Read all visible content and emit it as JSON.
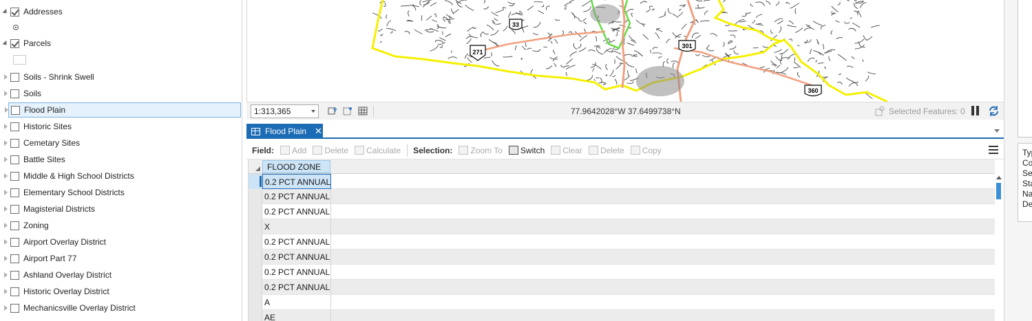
{
  "contents": {
    "layers": [
      {
        "label": "Addresses",
        "checked": true,
        "expanded": true,
        "selected": false
      },
      {
        "label": "Parcels",
        "checked": true,
        "expanded": true,
        "selected": false
      },
      {
        "label": "Soils - Shrink Swell",
        "checked": false,
        "expanded": false,
        "selected": false
      },
      {
        "label": "Soils",
        "checked": false,
        "expanded": false,
        "selected": false
      },
      {
        "label": "Flood Plain",
        "checked": false,
        "expanded": false,
        "selected": true
      },
      {
        "label": "Historic Sites",
        "checked": false,
        "expanded": false,
        "selected": false
      },
      {
        "label": "Cemetary Sites",
        "checked": false,
        "expanded": false,
        "selected": false
      },
      {
        "label": "Battle Sites",
        "checked": false,
        "expanded": false,
        "selected": false
      },
      {
        "label": "Middle & High School Districts",
        "checked": false,
        "expanded": false,
        "selected": false
      },
      {
        "label": "Elementary School Districts",
        "checked": false,
        "expanded": false,
        "selected": false
      },
      {
        "label": "Magisterial Districts",
        "checked": false,
        "expanded": false,
        "selected": false
      },
      {
        "label": "Zoning",
        "checked": false,
        "expanded": false,
        "selected": false
      },
      {
        "label": "Airport Overlay District",
        "checked": false,
        "expanded": false,
        "selected": false
      },
      {
        "label": "Airport Part 77",
        "checked": false,
        "expanded": false,
        "selected": false
      },
      {
        "label": "Ashland Overlay District",
        "checked": false,
        "expanded": false,
        "selected": false
      },
      {
        "label": "Historic Overlay District",
        "checked": false,
        "expanded": false,
        "selected": false
      },
      {
        "label": "Mechanicsville Overlay District",
        "checked": false,
        "expanded": false,
        "selected": false
      }
    ]
  },
  "map": {
    "route_shields": [
      "33",
      "271",
      "301",
      "360"
    ],
    "colors": {
      "county_boundary": "#f5f000",
      "district_boundary": "#66dd44",
      "major_roads": "#f0a080",
      "roads": "#555555"
    }
  },
  "status_bar": {
    "scale": "1:313,365",
    "coordinates": "77.9642028°W 37.6499738°N",
    "selected_features": "Selected Features: 0"
  },
  "attribute_table": {
    "tab_label": "Flood Plain",
    "toolbar": {
      "field_label": "Field:",
      "add": "Add",
      "delete": "Delete",
      "calculate": "Calculate",
      "selection_label": "Selection:",
      "zoom_to": "Zoom To",
      "switch": "Switch",
      "clear": "Clear",
      "delete_sel": "Delete",
      "copy": "Copy"
    },
    "column_header": "FLOOD ZONE",
    "rows": [
      "0.2 PCT ANNUAL",
      "0.2 PCT ANNUAL",
      "0.2 PCT ANNUAL",
      "X",
      "0.2 PCT ANNUAL",
      "0.2 PCT ANNUAL",
      "0.2 PCT ANNUAL",
      "0.2 PCT ANNUAL",
      "A",
      "AE"
    ]
  },
  "right_panel": {
    "lines": [
      "Typ",
      "Co",
      "Sev",
      "Sta",
      "Na",
      "De"
    ]
  }
}
